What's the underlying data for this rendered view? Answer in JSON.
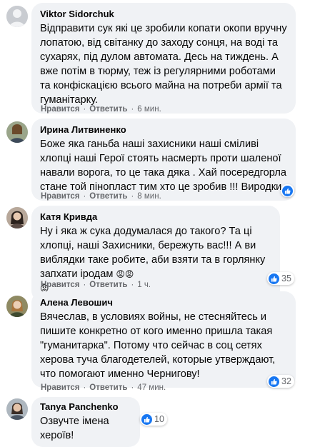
{
  "ui": {
    "like_label": "Нравится",
    "reply_label": "Ответить",
    "separator": "·"
  },
  "comments": [
    {
      "author": "Viktor Sidorchuk",
      "text": "Відправити сук які це зробили копати окопи вручну лопатою, від світанку до заходу сонця, на воді та сухарях, під дулом автомата. Десь на тиждень. А вже потім в тюрму, теж із регулярними роботами та конфіскацією всього майна на потреби армії та гуманітарку.",
      "time": "6 мин.",
      "reactions": ""
    },
    {
      "author": "Ирина Литвиненко",
      "text": "Боже яка ганьба наші захисники наші сміливі хлопці наші Герої стоять насмерть проти шаленої навали ворога, то це така дяка . Хай посередгорла стане той пінопласт тим хто це зробив !!! Виродки",
      "time": "8 мин.",
      "reactions": ""
    },
    {
      "author": "Катя Кривда",
      "text": "Ну і яка ж сука додумалася до такого? Та ці хлопці, наші Захисники, бережуть вас!!! А ви виблядки таке робите, аби взяти та в горлянку запхати іродам",
      "time": "1 ч.",
      "reactions": "35"
    },
    {
      "author": "Алена Левошич",
      "text": "Вячеслав, в условиях войны, не стесняйтесь и пишите конкретно от кого именно пришла такая \"гуманитарка\". Потому что сейчас в соц сетях херова туча благодетелей, которые утверждают, что помогают именно Чернигову!",
      "time": "47 мин.",
      "reactions": "32"
    },
    {
      "author": "Tanya Panchenko",
      "text": "Озвучте імена хероїв!",
      "time": "",
      "reactions": "10"
    }
  ],
  "colors": {
    "bubble": "#f0f2f5",
    "meta": "#65676b",
    "like_blue": "#1877f2",
    "angry": "#e9710f"
  }
}
